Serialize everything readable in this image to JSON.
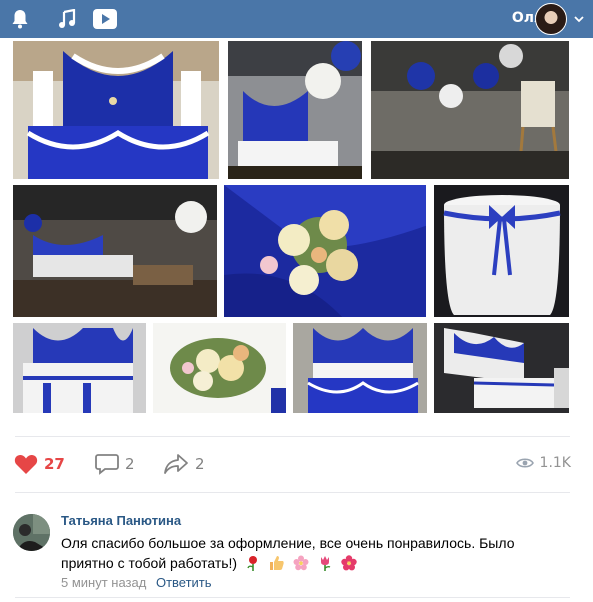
{
  "header": {
    "user_name": "Оля",
    "icons": [
      "bell-icon",
      "music-icon",
      "video-icon",
      "chevron-down-icon"
    ],
    "colors": {
      "bar": "#4a76a8"
    }
  },
  "gallery": {
    "photos": [
      "head-table-blue-drapery",
      "head-table-balloons",
      "seating-chart-stand-balloons",
      "banquet-hall-wide",
      "blue-ribbon-flower-bouquet",
      "round-table-blue-bow",
      "head-table-ribbons",
      "floral-arrangement",
      "head-table-lights",
      "side-view-head-table"
    ]
  },
  "actions": {
    "likes": "27",
    "comments": "2",
    "shares": "2",
    "views": "1.1K",
    "colors": {
      "like": "#e64646",
      "muted": "#828282"
    }
  },
  "comment": {
    "author": "Татьяна Панютина",
    "text": "Оля спасибо большое за оформление, все очень понравилось. Было приятно с тобой работать!)",
    "emoji": [
      "rose-icon",
      "thumbs-up-icon",
      "cherry-blossom-icon",
      "tulip-icon",
      "hibiscus-icon"
    ],
    "time": "5 минут назад",
    "reply_label": "Ответить",
    "colors": {
      "link": "#2a5885"
    }
  }
}
